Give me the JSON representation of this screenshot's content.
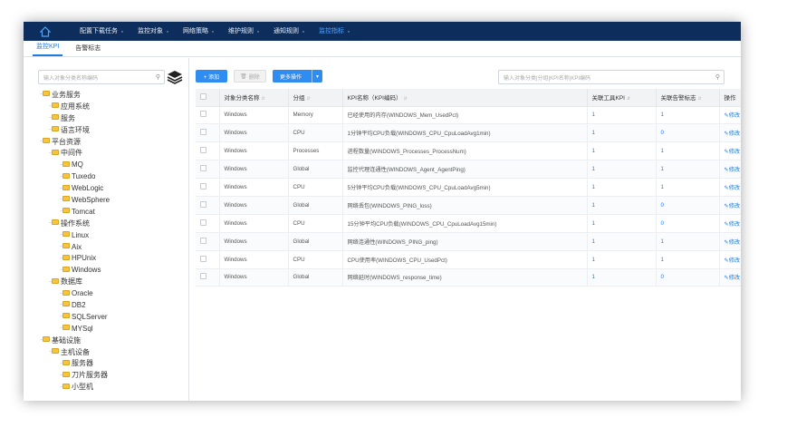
{
  "nav": {
    "items": [
      {
        "label": "配置下载任务",
        "sup": "*",
        "active": false
      },
      {
        "label": "监控对象",
        "sup": "*",
        "active": false
      },
      {
        "label": "网络策略",
        "sup": "*",
        "active": false
      },
      {
        "label": "维护规则",
        "sup": "*",
        "active": false
      },
      {
        "label": "通知规则",
        "sup": "*",
        "active": false
      },
      {
        "label": "监控指标",
        "sup": "*",
        "active": true
      }
    ]
  },
  "subtabs": [
    {
      "label": "监控KPI",
      "active": true
    },
    {
      "label": "告警标志",
      "active": false
    }
  ],
  "left": {
    "search_placeholder": "输入对象分类名称编码",
    "tree": [
      {
        "label": "业务服务",
        "level": 0
      },
      {
        "label": "应用系统",
        "level": 1
      },
      {
        "label": "服务",
        "level": 1
      },
      {
        "label": "语言环境",
        "level": 1
      },
      {
        "label": "平台资源",
        "level": 0
      },
      {
        "label": "中间件",
        "level": 1
      },
      {
        "label": "MQ",
        "level": 2
      },
      {
        "label": "Tuxedo",
        "level": 2
      },
      {
        "label": "WebLogic",
        "level": 2
      },
      {
        "label": "WebSphere",
        "level": 2
      },
      {
        "label": "Tomcat",
        "level": 2
      },
      {
        "label": "操作系统",
        "level": 1
      },
      {
        "label": "Linux",
        "level": 2
      },
      {
        "label": "Aix",
        "level": 2
      },
      {
        "label": "HPUnix",
        "level": 2
      },
      {
        "label": "Windows",
        "level": 2
      },
      {
        "label": "数据库",
        "level": 1
      },
      {
        "label": "Oracle",
        "level": 2
      },
      {
        "label": "DB2",
        "level": 2
      },
      {
        "label": "SQLServer",
        "level": 2
      },
      {
        "label": "MYSql",
        "level": 2
      },
      {
        "label": "基础设施",
        "level": 0
      },
      {
        "label": "主机设备",
        "level": 1
      },
      {
        "label": "服务器",
        "level": 2
      },
      {
        "label": "刀片服务器",
        "level": 2
      },
      {
        "label": "小型机",
        "level": 2
      }
    ]
  },
  "toolbar": {
    "add_label": "+ 添加",
    "delete_label": "删除",
    "more_label": "更多操作",
    "search_placeholder": "输入对象分类|分组|KPI名称|KPI编码"
  },
  "table": {
    "headers": [
      "对象分类名称",
      "分组",
      "KPI名称（KPI编码）",
      "关联工具KPI",
      "关联告警标志",
      "操作"
    ],
    "rows": [
      [
        "Windows",
        "Memory",
        "已经使用的内存(WINDOWS_Mem_UsedPct)",
        "1",
        "1",
        "修改"
      ],
      [
        "Windows",
        "CPU",
        "1分钟平均CPU负载(WINDOWS_CPU_CpuLoadAvg1min)",
        "1",
        "0",
        "修改"
      ],
      [
        "Windows",
        "Processes",
        "进程数量(WINDOWS_Processes_ProcessNum)",
        "1",
        "1",
        "修改"
      ],
      [
        "Windows",
        "Global",
        "监控代理连通性(WINDOWS_Agent_AgentPing)",
        "1",
        "1",
        "修改"
      ],
      [
        "Windows",
        "CPU",
        "5分钟平均CPU负载(WINDOWS_CPU_CpuLoadAvg5min)",
        "1",
        "1",
        "修改"
      ],
      [
        "Windows",
        "Global",
        "网络丢包(WINDOWS_PING_loss)",
        "1",
        "0",
        "修改"
      ],
      [
        "Windows",
        "CPU",
        "15分钟平均CPU负载(WINDOWS_CPU_CpuLoadAvg15min)",
        "1",
        "0",
        "修改"
      ],
      [
        "Windows",
        "Global",
        "网络连通性(WINDOWS_PING_ping)",
        "1",
        "1",
        "修改"
      ],
      [
        "Windows",
        "CPU",
        "CPU使用率(WINDOWS_CPU_UsedPct)",
        "1",
        "1",
        "修改"
      ],
      [
        "Windows",
        "Global",
        "网络延时(WINDOWS_response_time)",
        "1",
        "0",
        "修改"
      ]
    ]
  }
}
